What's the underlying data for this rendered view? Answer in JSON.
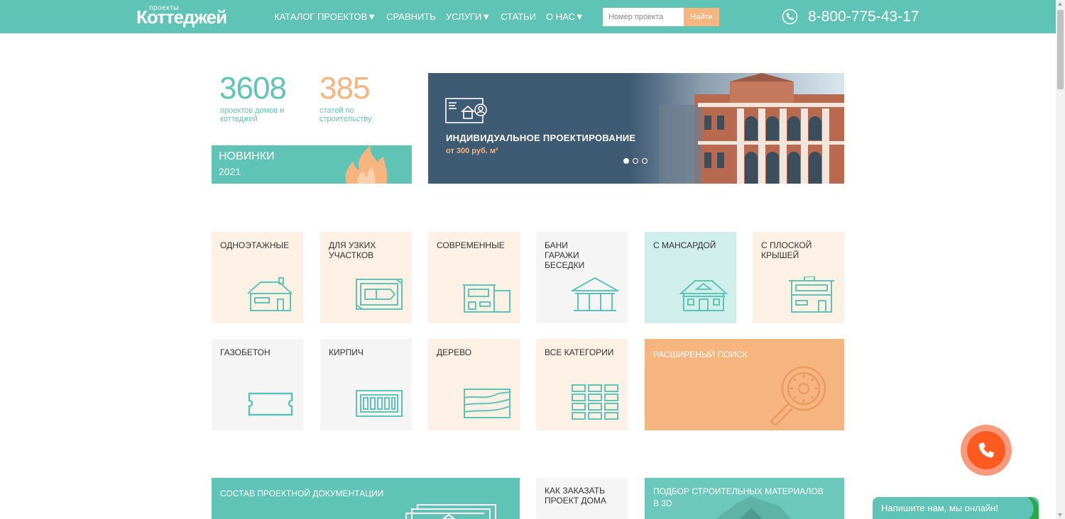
{
  "header": {
    "logo_small": "проекты",
    "logo_big": "Коттеджей",
    "nav": [
      {
        "label": "КАТАЛОГ ПРОЕКТОВ▼"
      },
      {
        "label": "СРАВНИТЬ"
      },
      {
        "label": "УСЛУГИ▼"
      },
      {
        "label": "СТАТЬИ"
      },
      {
        "label": "О НАС▼"
      }
    ],
    "search_placeholder": "Номер проекта",
    "search_button": "Найти",
    "phone": "8-800-775-43-17"
  },
  "stats": [
    {
      "number": "3608",
      "label": "проектов домов и коттеджей",
      "color": "#5fc4b5"
    },
    {
      "number": "385",
      "label": "статей по строительству",
      "color": "#f6b47f"
    }
  ],
  "new_projects": {
    "title": "НОВИНКИ",
    "year": "2021"
  },
  "banner": {
    "title": "ИНДИВИДУАЛЬНОЕ ПРОЕКТИРОВАНИЕ",
    "subtitle": "от  300 руб. м²",
    "slides": 3,
    "active_slide": 1
  },
  "categories": [
    {
      "label": "ОДНОЭТАЖНЫЕ",
      "icon": "one-story-house-icon"
    },
    {
      "label": "ДЛЯ УЗКИХ\nУЧАСТКОВ",
      "icon": "narrow-plot-icon"
    },
    {
      "label": "СОВРЕМЕННЫЕ",
      "icon": "modern-house-icon"
    },
    {
      "label": "БАНИ\nГАРАЖИ\nБЕСЕДКИ",
      "icon": "gazebo-icon"
    },
    {
      "label": "С МАНСАРДОЙ",
      "icon": "attic-house-icon"
    },
    {
      "label": "С ПЛОСКОЙ\nКРЫШЕЙ",
      "icon": "flat-roof-house-icon"
    },
    {
      "label": "ГАЗОБЕТОН",
      "icon": "gas-block-icon"
    },
    {
      "label": "КИРПИЧ",
      "icon": "brick-icon"
    },
    {
      "label": "ДЕРЕВО",
      "icon": "wood-icon"
    },
    {
      "label": "ВСЕ КАТЕГОРИИ",
      "icon": "all-categories-icon"
    }
  ],
  "advanced_search": {
    "label": "РАСШИРЕНЫЙ ПОИСК"
  },
  "bottom": {
    "documentation": "СОСТАВ ПРОЕКТНОЙ ДОКУМЕНТАЦИИ",
    "how_to_order": "КАК ЗАКАЗАТЬ\nПРОЕКТ ДОМА",
    "materials": "ПОДБОР СТРОИТЕЛЬНЫХ МАТЕРИАЛОВ\nВ 3D"
  },
  "chat": {
    "text": "Напишите нам, мы онлайн!"
  },
  "colors": {
    "teal": "#5fc4b5",
    "peach": "#f6b47f",
    "orange": "#ff5a1f",
    "banner_bg": "#3f5a73"
  }
}
